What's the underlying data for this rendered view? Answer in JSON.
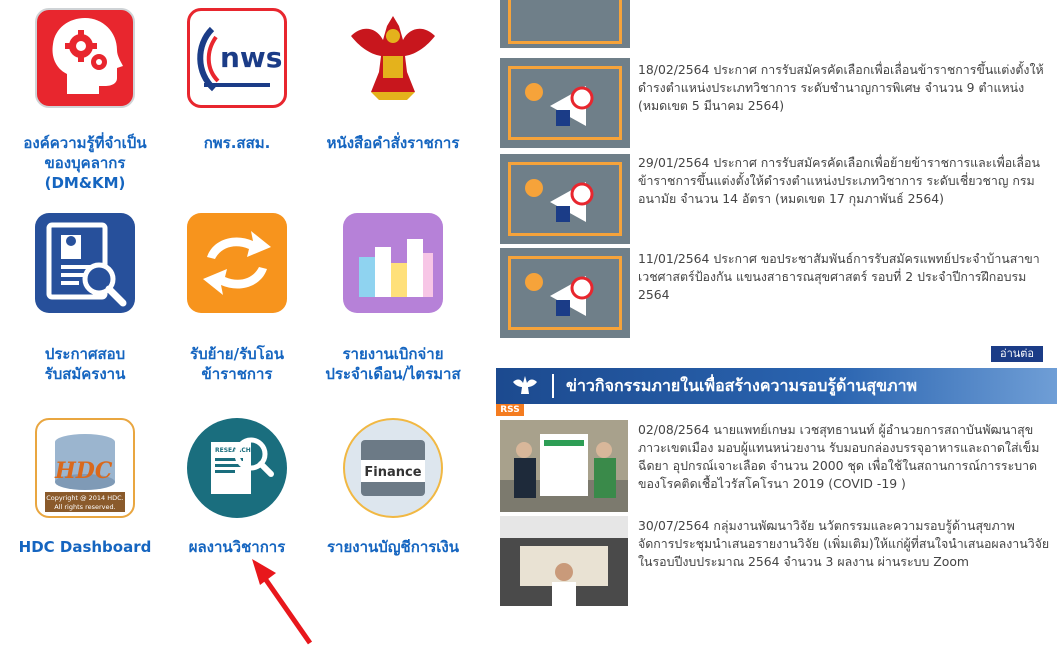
{
  "tiles": [
    {
      "label": "องค์ความรู้ที่จำเป็น\nของบุคลากร\n(DM&KM)",
      "icon": "gear-head-icon",
      "color": "#e8262e"
    },
    {
      "label": "กพร.สสม.",
      "icon": "nws-logo-icon",
      "logo_text": "nws",
      "color": "#ffffff"
    },
    {
      "label": "หนังสือคำสั่งราชการ",
      "icon": "garuda-emblem-icon",
      "color": "#ffffff"
    },
    {
      "label": "ประกาศสอบ\nรับสมัครงาน",
      "icon": "document-search-icon",
      "color": "#27509b"
    },
    {
      "label": "รับย้าย/รับโอน\nข้าราชการ",
      "icon": "swap-arrows-icon",
      "color": "#f7941d"
    },
    {
      "label": "รายงานเบิกจ่าย\nประจำเดือน/ไตรมาส",
      "icon": "bar-chart-icon",
      "color": "#b681d8"
    },
    {
      "label": "HDC Dashboard",
      "icon": "hdc-database-icon",
      "logo_text": "HDC",
      "copyright": "Copyright @ 2014 HDC.\nAll rights reserved.",
      "color": "#ffffff"
    },
    {
      "label": "ผลงานวิชาการ",
      "icon": "research-magnifier-icon",
      "logo_text": "RESEARCH",
      "color": "#1a6e7e"
    },
    {
      "label": "รายงานบัญชีการเงิน",
      "icon": "finance-calculator-icon",
      "logo_text": "Finance",
      "color": "#ffffff"
    }
  ],
  "news": [
    {
      "text": "18/02/2564 ประกาศ การรับสมัครคัดเลือกเพื่อเลื่อนข้าราชการขึ้นแต่งตั้งให้ดำรงตำแหน่งประเภทวิชาการ ระดับชำนาญการพิเศษ จำนวน 9 ตำแหน่ง (หมดเขต 5 มีนาคม 2564)"
    },
    {
      "text": "29/01/2564 ประกาศ การรับสมัครคัดเลือกเพื่อย้ายข้าราชการและเพื่อเลื่อนข้าราชการขึ้นแต่งตั้งให้ดำรงตำแหน่งประเภทวิชาการ ระดับเชี่ยวชาญ กรมอนามัย จำนวน 14 อัตรา (หมดเขต 17 กุมภาพันธ์ 2564)"
    },
    {
      "text": "11/01/2564 ประกาศ ขอประชาสัมพันธ์การรับสมัครแพทย์ประจำบ้านสาขาเวชศาสตร์ป้องกัน แขนงสาธารณสุขศาสตร์ รอบที่ 2 ประจำปีการฝึกอบรม 2564"
    }
  ],
  "read_more": "อ่านต่อ",
  "activity_section": {
    "title": "ข่าวกิจกรรมภายในเพื่อสร้างความรอบรู้ด้านสุขภาพ",
    "rss": "RSS",
    "items": [
      {
        "text": "02/08/2564 นายแพทย์เกษม เวชสุทธานนท์ ผู้อำนวยการสถาบันพัฒนาสุขภาวะเขตเมือง มอบผู้แทนหน่วยงาน รับมอบกล่องบรรจุอาหารและถาดใส่เข็มฉีดยา อุปกรณ์เจาะเลือด จำนวน 2000 ชุด เพื่อใช้ในสถานการณ์การระบาดของโรคติดเชื้อไวรัสโคโรนา 2019 (COVID -19 )"
      },
      {
        "text": "30/07/2564 กลุ่มงานพัฒนาวิจัย นวัตกรรมและความรอบรู้ด้านสุขภาพ จัดการประชุมนำเสนอรายงานวิจัย (เพิ่มเติม)ให้แก่ผู้ที่สนใจนำเสนอผลงานวิจัยในรอบปีงบประมาณ 2564 จำนวน 3 ผลงาน ผ่านระบบ Zoom"
      }
    ]
  },
  "colors": {
    "tile_label": "#1565c0",
    "annotation_arrow": "#e8171c",
    "section_bar": "#1c4a8f",
    "thumb_border": "#f6a33a"
  }
}
